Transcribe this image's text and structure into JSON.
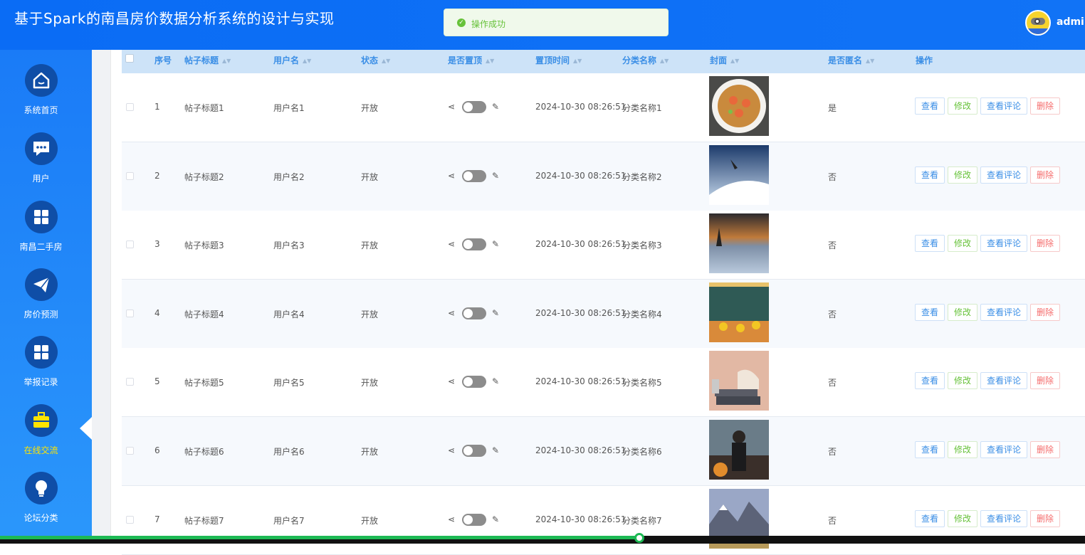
{
  "header": {
    "title": "基于Spark的南昌房价数据分析系统的设计与实现",
    "user_name": "admin"
  },
  "toast": {
    "message": "操作成功"
  },
  "sidebar": {
    "items": [
      {
        "label": "系统首页",
        "icon": "home-icon"
      },
      {
        "label": "用户",
        "icon": "chat-icon"
      },
      {
        "label": "南昌二手房",
        "icon": "grid-icon"
      },
      {
        "label": "房价预测",
        "icon": "send-icon"
      },
      {
        "label": "举报记录",
        "icon": "grid-icon"
      },
      {
        "label": "在线交流",
        "icon": "briefcase-icon",
        "active": true
      },
      {
        "label": "论坛分类",
        "icon": "bulb-icon"
      }
    ]
  },
  "table": {
    "columns": {
      "index": "序号",
      "title": "帖子标题",
      "username": "用户名",
      "status": "状态",
      "pinned": "是否置顶",
      "pin_time": "置顶时间",
      "category": "分类名称",
      "cover": "封面",
      "anonymous": "是否匿名",
      "actions": "操作"
    },
    "action_labels": {
      "view": "查看",
      "edit": "修改",
      "comments": "查看评论",
      "delete": "删除"
    },
    "rows": [
      {
        "index": "1",
        "title": "帖子标题1",
        "username": "用户名1",
        "status": "开放",
        "pin_time": "2024-10-30 08:26:51",
        "category": "分类名称1",
        "anonymous": "是",
        "pinned": false
      },
      {
        "index": "2",
        "title": "帖子标题2",
        "username": "用户名2",
        "status": "开放",
        "pin_time": "2024-10-30 08:26:51",
        "category": "分类名称2",
        "anonymous": "否",
        "pinned": false
      },
      {
        "index": "3",
        "title": "帖子标题3",
        "username": "用户名3",
        "status": "开放",
        "pin_time": "2024-10-30 08:26:51",
        "category": "分类名称3",
        "anonymous": "否",
        "pinned": false
      },
      {
        "index": "4",
        "title": "帖子标题4",
        "username": "用户名4",
        "status": "开放",
        "pin_time": "2024-10-30 08:26:51",
        "category": "分类名称4",
        "anonymous": "否",
        "pinned": false
      },
      {
        "index": "5",
        "title": "帖子标题5",
        "username": "用户名5",
        "status": "开放",
        "pin_time": "2024-10-30 08:26:51",
        "category": "分类名称5",
        "anonymous": "否",
        "pinned": false
      },
      {
        "index": "6",
        "title": "帖子标题6",
        "username": "用户名6",
        "status": "开放",
        "pin_time": "2024-10-30 08:26:51",
        "category": "分类名称6",
        "anonymous": "否",
        "pinned": false
      },
      {
        "index": "7",
        "title": "帖子标题7",
        "username": "用户名7",
        "status": "开放",
        "pin_time": "2024-10-30 08:26:51",
        "category": "分类名称7",
        "anonymous": "否",
        "pinned": false
      }
    ]
  },
  "video_progress": 0.59
}
